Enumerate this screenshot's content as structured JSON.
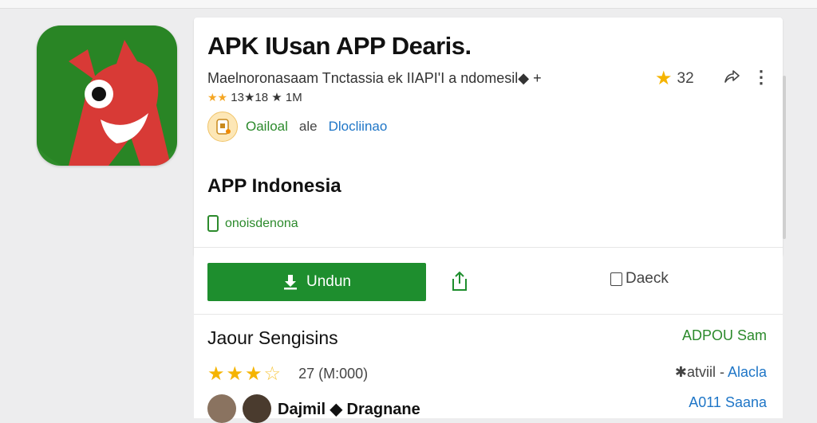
{
  "app": {
    "title": "APK IUsan APP Dearis.",
    "subtitle": "Maelnoronasaam Tnctassia ek IIAPI'I a ndomesil◆ +",
    "meta": "13★18 ★ 1M",
    "meta_stars": "★★",
    "rating_value": "32",
    "developer_name": "Oailoal",
    "developer_sep": "ale",
    "developer_link": "Dlocliinao"
  },
  "section": {
    "title": "APP Indonesia",
    "badge_label": "​onoisdenona"
  },
  "actions": {
    "download_label": "Undun",
    "back_label": "Daeck"
  },
  "reviews": {
    "title": "Jaour Sengisins",
    "link": "ADPOU Sam",
    "stars_filled": "★★★",
    "stars_empty": "☆",
    "count": "27  (M:000)",
    "right_prefix": "✱atviil -",
    "right_link": "Alacla",
    "reviewer_name": "Dajmil ◆ Dragnane",
    "reviewer_right": "A011  Saana"
  },
  "icons": {
    "app_icon": "red-monster-icon",
    "rating_star": "star-icon",
    "share": "share-icon",
    "more": "more-vertical-icon",
    "developer": "developer-avatar-icon",
    "download": "download-icon",
    "back": "back-icon"
  },
  "colors": {
    "accent_green": "#1e8e2e",
    "link_blue": "#1f76c7",
    "star_yellow": "#f5b400"
  }
}
